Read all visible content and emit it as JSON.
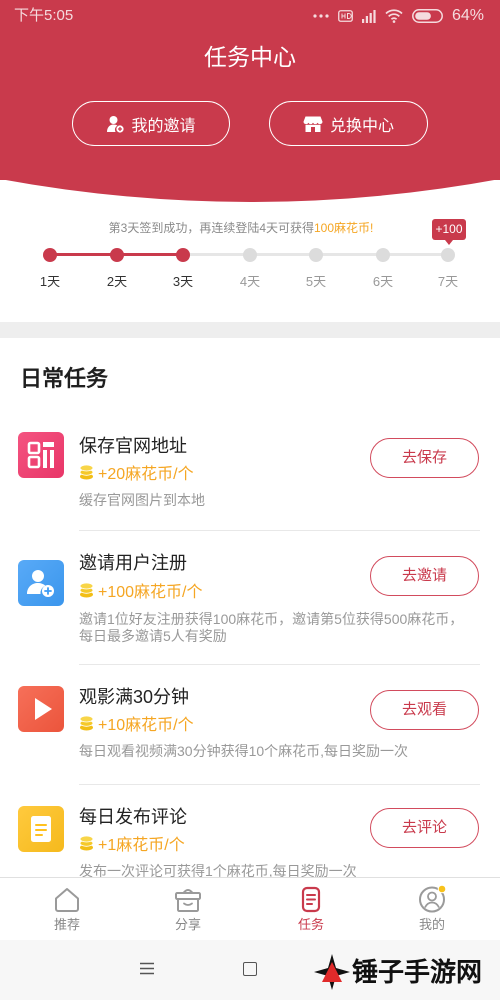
{
  "status_bar": {
    "time": "下午5:05",
    "battery": "64%"
  },
  "header": {
    "title": "任务中心",
    "buttons": [
      {
        "label": "我的邀请",
        "icon": "user-add-icon"
      },
      {
        "label": "兑换中心",
        "icon": "store-icon"
      }
    ]
  },
  "checkin": {
    "message": "第3天签到成功，再连续登陆4天可获得",
    "highlight": "100麻花币!",
    "bonus_badge": "+100",
    "completed_days": 3,
    "days": [
      "1天",
      "2天",
      "3天",
      "4天",
      "5天",
      "6天",
      "7天"
    ]
  },
  "daily": {
    "title": "日常任务",
    "tasks": [
      {
        "name": "保存官网地址",
        "reward": "+20麻花币/个",
        "description": "缓存官网图片到本地",
        "action": "去保存",
        "icon": "qr-code-icon",
        "color": "#F2386C"
      },
      {
        "name": "邀请用户注册",
        "reward": "+100麻花币/个",
        "description": "邀请1位好友注册获得100麻花币，邀请第5位获得500麻花币，每日最多邀请5人有奖励",
        "action": "去邀请",
        "icon": "user-add-icon",
        "color": "#3D9CF6"
      },
      {
        "name": "观影满30分钟",
        "reward": "+10麻花币/个",
        "description": "每日观看视频满30分钟获得10个麻花币,每日奖励一次",
        "action": "去观看",
        "icon": "play-icon",
        "color": "#F5583E"
      },
      {
        "name": "每日发布评论",
        "reward": "+1麻花币/个",
        "description": "发布一次评论可获得1个麻花币,每日奖励一次",
        "action": "去评论",
        "icon": "document-icon",
        "color": "#FFC11E"
      }
    ]
  },
  "bottom_nav": {
    "items": [
      {
        "label": "推荐",
        "icon": "home-icon"
      },
      {
        "label": "分享",
        "icon": "gift-icon"
      },
      {
        "label": "任务",
        "icon": "task-list-icon"
      },
      {
        "label": "我的",
        "icon": "user-avatar-icon"
      }
    ],
    "active_index": 2
  },
  "watermark": "锤子手游网",
  "colors": {
    "primary": "#C93A4C",
    "reward": "#F5A623",
    "muted": "#999999"
  }
}
